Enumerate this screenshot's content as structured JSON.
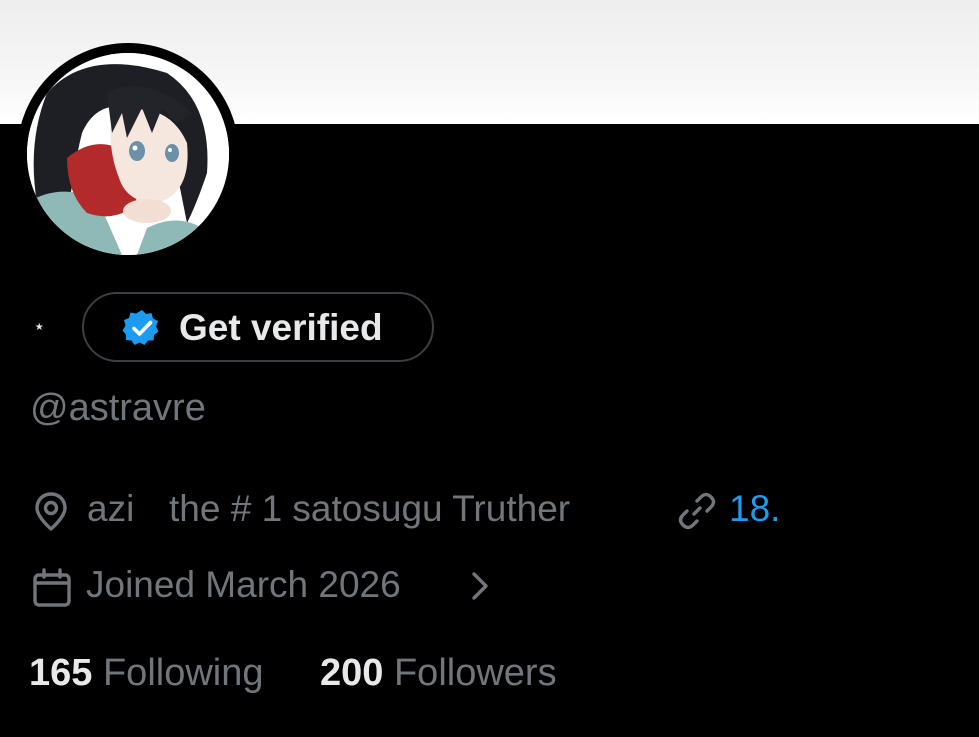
{
  "profile": {
    "display_name_glyph": "⋆",
    "verify_button_label": "Get verified",
    "handle": "@astravre",
    "location": "azi",
    "bio_fragment": "the # 1 satosugu Truther",
    "website": "18.",
    "joined": "Joined March 2026"
  },
  "stats": {
    "following_count": "165",
    "following_label": "Following",
    "followers_count": "200",
    "followers_label": "Followers"
  },
  "icons": {
    "location": "location-pin-icon",
    "link": "link-icon",
    "calendar": "calendar-icon",
    "chevron": "chevron-right-icon",
    "verified": "verified-badge-icon"
  },
  "colors": {
    "background": "#000000",
    "primary_text": "#e7e9ea",
    "secondary_text": "#71767b",
    "accent": "#1d9bf0",
    "button_border": "#3a3f44"
  }
}
